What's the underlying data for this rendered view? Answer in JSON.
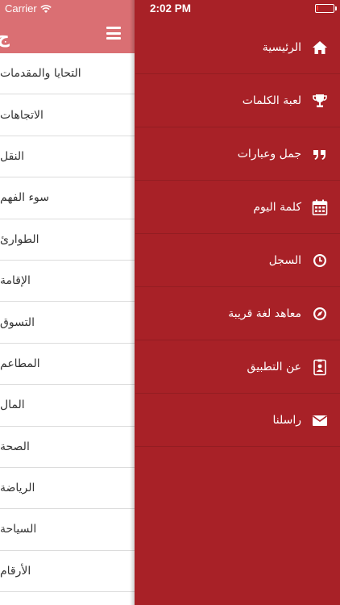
{
  "status_bar": {
    "carrier": "Carrier",
    "time": "2:02 PM"
  },
  "header": {
    "title_fragment": "ج"
  },
  "categories": [
    "التحايا والمقدمات",
    "الاتجاهات",
    "النقل",
    "سوء الفهم",
    "الطوارئ",
    "الإقامة",
    "التسوق",
    "المطاعم",
    "المال",
    "الصحة",
    "الرياضة",
    "السياحة",
    "الأرقام"
  ],
  "menu": [
    {
      "label": "الرئيسية",
      "icon": "home-icon"
    },
    {
      "label": "لعبة الكلمات",
      "icon": "trophy-icon"
    },
    {
      "label": "جمل وعبارات",
      "icon": "quote-icon"
    },
    {
      "label": "كلمة اليوم",
      "icon": "calendar-icon"
    },
    {
      "label": "السجل",
      "icon": "clock-icon"
    },
    {
      "label": "معاهد لغة قريبة",
      "icon": "compass-icon"
    },
    {
      "label": "عن التطبيق",
      "icon": "badge-icon"
    },
    {
      "label": "راسلنا",
      "icon": "envelope-icon"
    }
  ],
  "colors": {
    "menu_background": "#a82127",
    "header_background": "#da6f73",
    "content_background": "#ffffff"
  }
}
